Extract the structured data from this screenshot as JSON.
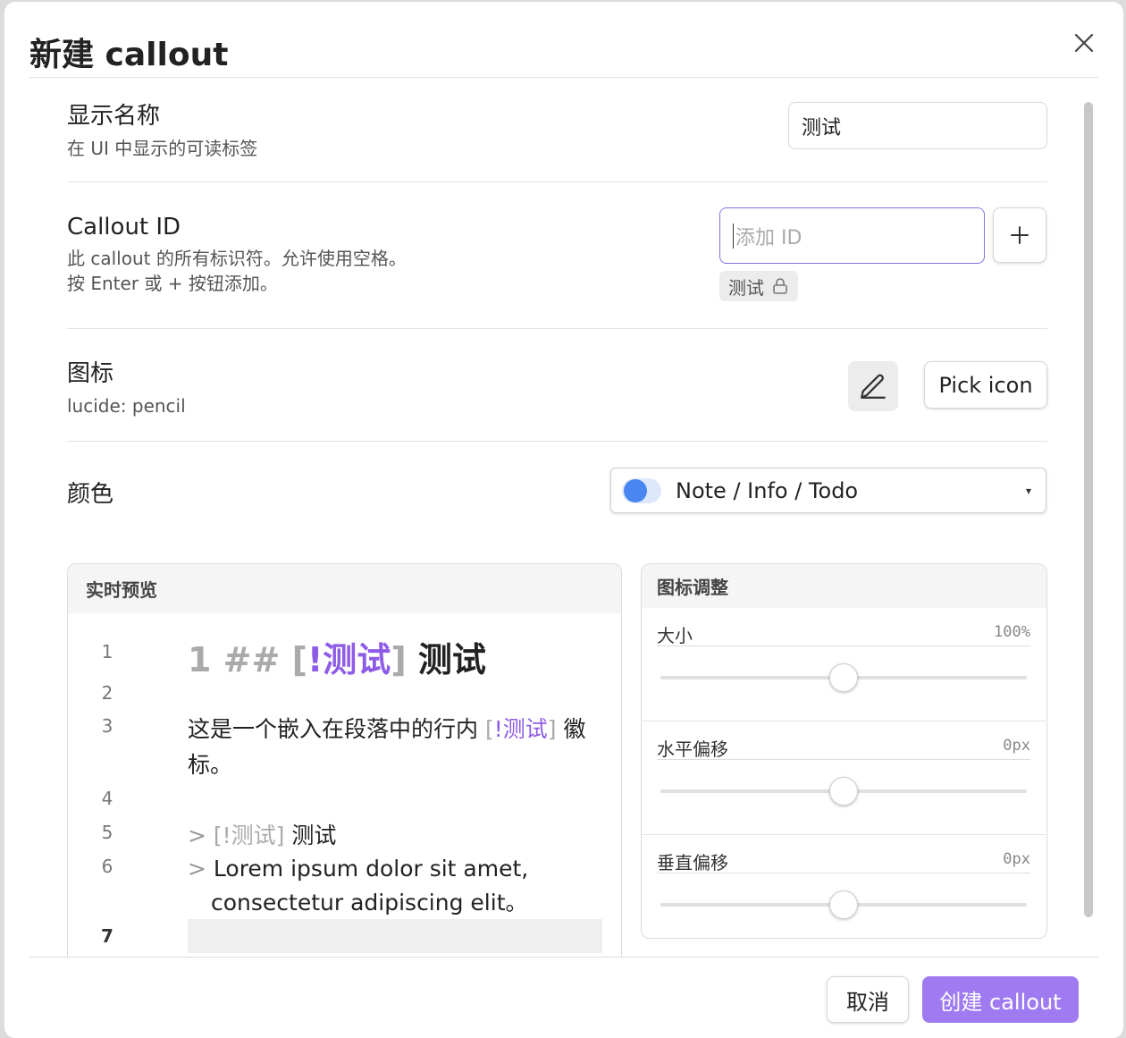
{
  "dialog": {
    "title": "新建 callout",
    "close_icon": "close-icon"
  },
  "settings": {
    "display_name": {
      "label": "显示名称",
      "desc": "在 UI 中显示的可读标签",
      "value": "测试"
    },
    "callout_id": {
      "label": "Callout ID",
      "desc_line1": "此 callout 的所有标识符。允许使用空格。",
      "desc_line2": "按 Enter 或 + 按钮添加。",
      "placeholder": "添加 ID",
      "add_button": "+",
      "tags": [
        {
          "label": "测试",
          "icon": "lock-icon"
        }
      ]
    },
    "icon": {
      "label": "图标",
      "desc": "lucide: pencil",
      "preview_icon": "pencil-icon",
      "pick_button": "Pick icon"
    },
    "color": {
      "label": "颜色",
      "selected": "Note / Info / Todo",
      "swatch_color": "#4a86f0",
      "arrow": "▾"
    }
  },
  "live_preview": {
    "title": "实时预览",
    "lines": [
      {
        "num": "1",
        "prefix": "1 ## ",
        "open": "[",
        "tag": "!测试",
        "close": "]",
        "text": " 测试"
      },
      {
        "num": "2"
      },
      {
        "num": "3",
        "text_before": "这是一个嵌入在段落中的行内 ",
        "open": "[",
        "tag": "!测试",
        "close": "]",
        "text_after": " 徽",
        "wrap": "标。"
      },
      {
        "num": "4"
      },
      {
        "num": "5",
        "quote": ">",
        "tag_full": "[!测试]",
        "text": " 测试"
      },
      {
        "num": "6",
        "quote": ">",
        "text": "Lorem ipsum dolor sit amet,",
        "wrap": "consectetur adipiscing elit。"
      },
      {
        "num": "7"
      }
    ]
  },
  "icon_adjust": {
    "title": "图标调整",
    "items": [
      {
        "label": "大小",
        "value": "100%",
        "level": 0.5
      },
      {
        "label": "水平偏移",
        "value": "0px",
        "level": 0.5
      },
      {
        "label": "垂直偏移",
        "value": "0px",
        "level": 0.5
      }
    ]
  },
  "footer": {
    "cancel": "取消",
    "create": "创建 callout",
    "accent": "#9f7af0"
  }
}
